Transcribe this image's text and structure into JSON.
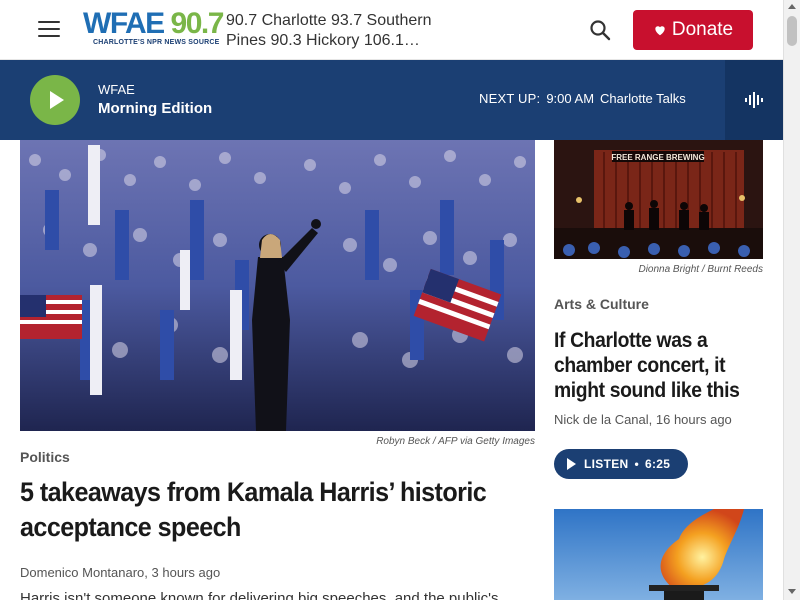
{
  "header": {
    "menu_icon": "hamburger-menu-icon",
    "logo": {
      "wfae": "WFAE",
      "freq": "90.7",
      "tagline": "CHARLOTTE'S NPR NEWS SOURCE"
    },
    "stations_line1": "90.7 Charlotte 93.7 Southern",
    "stations_line2": "Pines 90.3 Hickory 106.1…",
    "search_icon": "search-icon",
    "donate_label": "Donate",
    "donate_color": "#c8102e"
  },
  "player": {
    "station": "WFAE",
    "show": "Morning Edition",
    "next_up_label": "NEXT UP:",
    "next_up_time": "9:00 AM",
    "next_up_show": "Charlotte Talks",
    "bar_color": "#1b3f73",
    "play_color": "#7ab648"
  },
  "main_story": {
    "photo_credit_name": "Robyn Beck",
    "photo_credit_sep": "/",
    "photo_credit_source": "AFP via Getty Images",
    "section": "Politics",
    "headline": "5 takeaways from Kamala Harris’ historic acceptance speech",
    "byline": "Domenico Montanaro, 3 hours ago",
    "teaser": "Harris isn't someone known for delivering big speeches, and the public's"
  },
  "side_story": {
    "photo_credit_name": "Dionna Bright",
    "photo_credit_sep": "/",
    "photo_credit_source": "Burnt Reeds",
    "venue_sign": "FREE RANGE BREWING",
    "section": "Arts & Culture",
    "headline": "If Charlotte was a chamber concert, it might sound like this",
    "byline": "Nick de la Canal, 16 hours ago",
    "listen_label": "LISTEN",
    "listen_duration": "6:25"
  }
}
